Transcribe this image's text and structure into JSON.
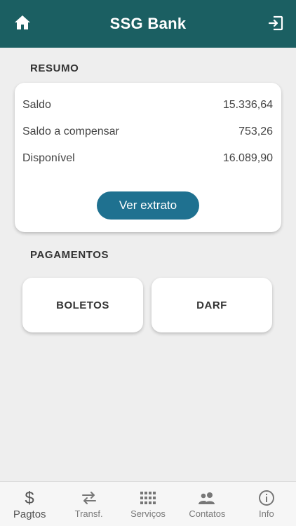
{
  "appbar": {
    "title": "SSG Bank",
    "home_icon": "home-icon",
    "exit_icon": "exit-icon"
  },
  "resumo": {
    "section_title": "RESUMO",
    "rows": [
      {
        "label": "Saldo",
        "value": "15.336,64"
      },
      {
        "label": "Saldo a compensar",
        "value": "753,26"
      },
      {
        "label": "Disponível",
        "value": "16.089,90"
      }
    ],
    "button_label": "Ver extrato"
  },
  "pagamentos": {
    "section_title": "PAGAMENTOS",
    "tiles": [
      "BOLETOS",
      "DARF"
    ]
  },
  "navbar": {
    "items": [
      {
        "label": "Pagtos",
        "icon": "dollar-icon",
        "active": true
      },
      {
        "label": "Transf.",
        "icon": "transfer-icon",
        "active": false
      },
      {
        "label": "Serviços",
        "icon": "grid-icon",
        "active": false
      },
      {
        "label": "Contatos",
        "icon": "contacts-icon",
        "active": false
      },
      {
        "label": "Info",
        "icon": "info-icon",
        "active": false
      }
    ]
  },
  "colors": {
    "appbar": "#1b5f62",
    "accent_button": "#1f7190",
    "background": "#eeeeee"
  }
}
